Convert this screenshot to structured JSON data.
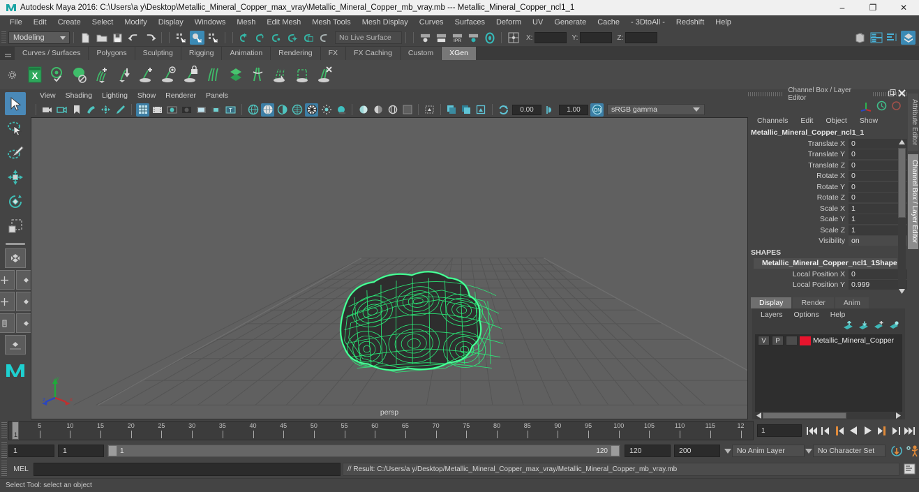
{
  "window": {
    "title": "Autodesk Maya 2016: C:\\Users\\a y\\Desktop\\Metallic_Mineral_Copper_max_vray\\Metallic_Mineral_Copper_mb_vray.mb  ---  Metallic_Mineral_Copper_ncl1_1",
    "app_icon": "maya-icon",
    "minimize": "–",
    "maximize": "❐",
    "close": "✕"
  },
  "menubar": {
    "items": [
      "File",
      "Edit",
      "Create",
      "Select",
      "Modify",
      "Display",
      "Windows",
      "Mesh",
      "Edit Mesh",
      "Mesh Tools",
      "Mesh Display",
      "Curves",
      "Surfaces",
      "Deform",
      "UV",
      "Generate",
      "Cache",
      "- 3DtoAll -",
      "Redshift",
      "Help"
    ]
  },
  "statusline": {
    "menuset": "Modeling",
    "live_surface": "No Live Surface",
    "axis_x_label": "X:",
    "axis_y_label": "Y:",
    "axis_z_label": "Z:",
    "axis_x_value": "",
    "axis_y_value": "",
    "axis_z_value": ""
  },
  "shelf": {
    "tabs": [
      {
        "label": "Curves / Surfaces",
        "active": false
      },
      {
        "label": "Polygons",
        "active": false
      },
      {
        "label": "Sculpting",
        "active": false
      },
      {
        "label": "Rigging",
        "active": false
      },
      {
        "label": "Animation",
        "active": false
      },
      {
        "label": "Rendering",
        "active": false
      },
      {
        "label": "FX",
        "active": false
      },
      {
        "label": "FX Caching",
        "active": false
      },
      {
        "label": "Custom",
        "active": false
      },
      {
        "label": "XGen",
        "active": true
      }
    ],
    "icons": [
      "xgen-editor-icon",
      "xgen-description-check-icon",
      "xgen-no-preview-icon",
      "xgen-add-guides-icon",
      "xgen-place-icon",
      "xgen-add-icon",
      "xgen-eye-icon",
      "xgen-lock-icon",
      "xgen-split-icon",
      "xgen-green-diamonds-icon",
      "xgen-strands-icon",
      "xgen-cut-icon",
      "xgen-clump-icon",
      "xgen-delete-icon"
    ]
  },
  "viewport": {
    "menus": [
      "View",
      "Shading",
      "Lighting",
      "Show",
      "Renderer",
      "Panels"
    ],
    "exposure_value": "0.00",
    "gamma_value": "1.00",
    "color_space": "sRGB gamma",
    "camera_label": "persp",
    "grid_color": "#606060",
    "wireframe_color": "#2bf07a"
  },
  "channel_box": {
    "panel_title": "Channel Box / Layer Editor",
    "menus": [
      "Channels",
      "Edit",
      "Object",
      "Show"
    ],
    "node_name": "Metallic_Mineral_Copper_ncl1_1",
    "attributes": [
      {
        "label": "Translate X",
        "value": "0"
      },
      {
        "label": "Translate Y",
        "value": "0"
      },
      {
        "label": "Translate Z",
        "value": "0"
      },
      {
        "label": "Rotate X",
        "value": "0"
      },
      {
        "label": "Rotate Y",
        "value": "0"
      },
      {
        "label": "Rotate Z",
        "value": "0"
      },
      {
        "label": "Scale X",
        "value": "1"
      },
      {
        "label": "Scale Y",
        "value": "1"
      },
      {
        "label": "Scale Z",
        "value": "1"
      },
      {
        "label": "Visibility",
        "value": "on"
      }
    ],
    "shapes_header": "SHAPES",
    "shape_name": "Metallic_Mineral_Copper_ncl1_1Shape",
    "shape_attributes": [
      {
        "label": "Local Position X",
        "value": "0"
      },
      {
        "label": "Local Position Y",
        "value": "0.999"
      }
    ]
  },
  "layer_editor": {
    "tabs": [
      {
        "label": "Display",
        "active": true
      },
      {
        "label": "Render",
        "active": false
      },
      {
        "label": "Anim",
        "active": false
      }
    ],
    "menus": [
      "Layers",
      "Options",
      "Help"
    ],
    "toolbar_icons": [
      "layer-move-up-icon",
      "layer-move-down-icon",
      "layer-new-icon",
      "layer-new-from-selected-icon"
    ],
    "layers": [
      {
        "visibility": "V",
        "playback": "P",
        "state": "",
        "color": "#e8142d",
        "name": "Metallic_Mineral_Copper"
      }
    ]
  },
  "side_tabs": [
    {
      "label": "Attribute Editor",
      "active": false
    },
    {
      "label": "Channel Box / Layer Editor",
      "active": true
    }
  ],
  "time_slider": {
    "tick_labels": [
      "5",
      "10",
      "15",
      "20",
      "25",
      "30",
      "35",
      "40",
      "45",
      "50",
      "55",
      "60",
      "65",
      "70",
      "75",
      "80",
      "85",
      "90",
      "95",
      "100",
      "105",
      "110",
      "115",
      "12"
    ],
    "current_frame_marker": "1",
    "current_frame_field": "1",
    "playback_buttons": [
      "go-to-start-icon",
      "step-back-keyframe-icon",
      "step-back-frame-icon",
      "play-backwards-icon",
      "play-forwards-icon",
      "step-forward-frame-icon",
      "step-forward-keyframe-icon",
      "go-to-end-icon"
    ]
  },
  "range_slider": {
    "anim_start": "1",
    "range_start": "1",
    "bar_start_label": "1",
    "bar_end_label": "120",
    "range_end": "120",
    "anim_end": "200",
    "anim_layer": "No Anim Layer",
    "character_set": "No Character Set",
    "right_icons": [
      "auto-keyframe-icon",
      "animation-preferences-icon"
    ]
  },
  "command_line": {
    "label": "MEL",
    "input_value": "",
    "result_text": "// Result: C:/Users/a y/Desktop/Metallic_Mineral_Copper_max_vray/Metallic_Mineral_Copper_mb_vray.mb",
    "script_editor_icon": "script-editor-icon"
  },
  "help_line": {
    "text": "Select Tool: select an object"
  },
  "toolbox": {
    "tools": [
      {
        "name": "select-tool",
        "selected": true
      },
      {
        "name": "lasso-select-tool",
        "selected": false
      },
      {
        "name": "paint-select-tool",
        "selected": false
      },
      {
        "name": "move-tool",
        "selected": false
      },
      {
        "name": "rotate-tool",
        "selected": false
      },
      {
        "name": "scale-tool",
        "selected": false
      }
    ],
    "layouts": [
      "single-perspective-layout",
      "four-view-layout",
      "outliner-persp-layout",
      "hypergraph-persp-layout",
      "persp-graph-layout"
    ]
  },
  "colors": {
    "accent_blue": "#3b8ab5",
    "panel_bg": "#444444",
    "viewport_bg": "#606060",
    "wireframe_green": "#2bf07a",
    "layer_red": "#e8142d",
    "title_bar": "#f0f0f0"
  }
}
